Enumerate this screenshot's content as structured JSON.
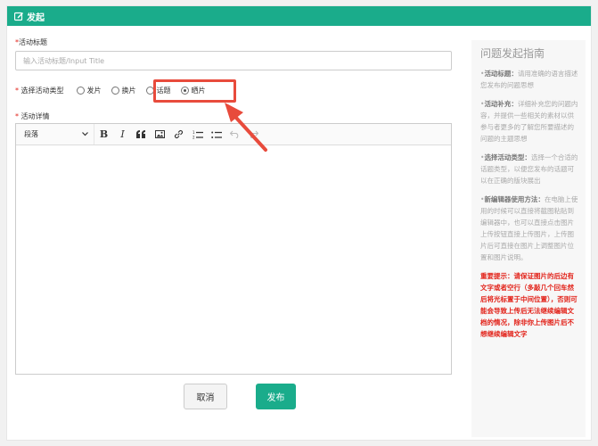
{
  "header": {
    "title": "发起",
    "icon": "edit-icon"
  },
  "form": {
    "title_label": "活动标题",
    "title_placeholder": "输入活动标题/Input Title",
    "title_value": "",
    "type_label": "选择活动类型",
    "type_options": [
      "发片",
      "换片",
      "话题",
      "晒片"
    ],
    "type_selected": "晒片",
    "detail_label": "活动详情",
    "required_mark": "*"
  },
  "editor": {
    "paragraph_select": "段落",
    "tools": [
      "bold-icon",
      "italic-icon",
      "quote-icon",
      "image-icon",
      "link-icon",
      "ordered-list-icon",
      "unordered-list-icon",
      "undo-icon",
      "redo-icon"
    ],
    "bold_label": "B",
    "italic_label": "I"
  },
  "actions": {
    "cancel": "取消",
    "publish": "发布"
  },
  "guide": {
    "title": "问题发起指南",
    "items": [
      {
        "head": "活动标题：",
        "text": "请用准确的语言描述您发布的问题思想"
      },
      {
        "head": "活动补充：",
        "text": "详细补充您的问题内容，并提供一些相关的素材以供参与者更多的了解您所要描述的问题的主题思想"
      },
      {
        "head": "选择活动类型：",
        "text": "选择一个合适的话题类型，以便您发布的话题可以在正确的版块展出"
      },
      {
        "head": "新编辑器使用方法：",
        "text": "在电脑上使用的时候可以直接将截图粘贴到编辑器中，也可以直接点击图片上传按钮直接上传图片，上传图片后可直接在图片上调整图片位置和图片说明。"
      }
    ],
    "bullet": "•",
    "warning": "重要提示：请保证图片的后边有文字或者空行（多敲几个回车然后将光标置于中间位置），否则可能会导致上传后无法继续编辑文档的情况，除非你上传图片后不想继续编辑文字"
  },
  "colors": {
    "accent": "#1aac8b",
    "highlight": "#e84b3c",
    "required": "#e2231a"
  }
}
